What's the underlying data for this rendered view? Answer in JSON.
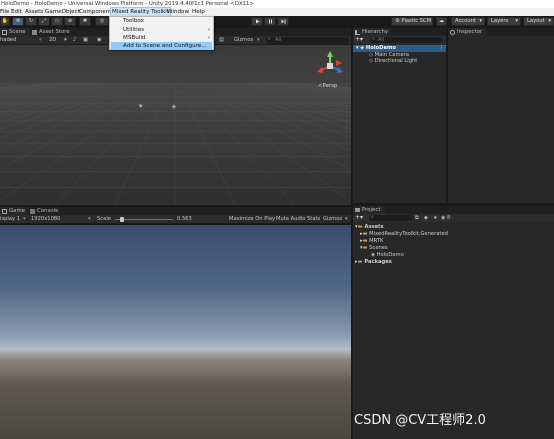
{
  "window": {
    "title": "HoloDemo - HoloDemo - Universal Windows Platform - Unity 2019.4.40f1c1 Personal <DX11>"
  },
  "menubar": {
    "items": [
      "File",
      "Edit",
      "Assets",
      "GameObject",
      "Component",
      "Mixed Reality Toolkit",
      "Window",
      "Help"
    ],
    "active": "Mixed Reality Toolkit"
  },
  "mrtk_menu": {
    "items": [
      {
        "label": "Toolbox",
        "submenu": false
      },
      {
        "label": "Utilities",
        "submenu": true
      },
      {
        "label": "MSBuild",
        "submenu": true
      },
      {
        "label": "Add to Scene and Configure...",
        "submenu": false
      }
    ],
    "highlighted": "Add to Scene and Configure..."
  },
  "toolbar": {
    "play_icon": "play-icon",
    "pause_icon": "pause-icon",
    "step_icon": "step-icon",
    "plastic_label": "Plastic SCM",
    "account_label": "Account",
    "layers_label": "Layers",
    "layout_label": "Layout"
  },
  "scene_panel": {
    "tabs": [
      "Scene",
      "Asset Store"
    ],
    "shading_mode": "haded",
    "mode_2d": "2D",
    "gizmos_label": "Gizmos",
    "search_placeholder": "All",
    "persp_label": "Persp"
  },
  "game_panel": {
    "tabs": [
      "Game",
      "Console"
    ],
    "display": "isplay 1",
    "resolution": "1920x1080",
    "scale_label": "Scale",
    "scale_value": "0.563",
    "scale_fraction": 0.1,
    "maximize_label": "Maximize On Play",
    "mute_label": "Mute Audio",
    "stats_label": "Stats",
    "gizmos_label": "Gizmos"
  },
  "hierarchy": {
    "tab": "Hierarchy",
    "search_placeholder": "All",
    "scene_name": "HoloDemo",
    "children": [
      "Main Camera",
      "Directional Light"
    ]
  },
  "inspector": {
    "tab": "Inspector"
  },
  "project": {
    "tab": "Project",
    "tree": [
      {
        "label": "Assets",
        "level": 0,
        "bold": true
      },
      {
        "label": "MixedRealityToolkit.Generated",
        "level": 1
      },
      {
        "label": "MRTK",
        "level": 1
      },
      {
        "label": "Scenes",
        "level": 1
      },
      {
        "label": "HoloDemo",
        "level": 2
      },
      {
        "label": "Packages",
        "level": 0,
        "bold": true
      }
    ],
    "badge_count": "8"
  },
  "watermark": "CSDN @CV工程师2.0",
  "colors": {
    "accent": "#2c5d87",
    "sky_top": "#3b4f75",
    "sky_horizon": "#aab8c8",
    "ground": "#4a4642"
  }
}
